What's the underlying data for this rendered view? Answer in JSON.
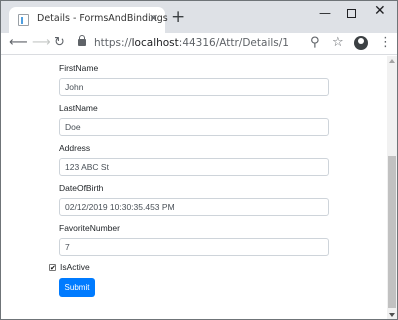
{
  "browser": {
    "tab_title": "Details - FormsAndBindings",
    "close_glyph": "✕",
    "new_tab_glyph": "+",
    "url_prefix": "https://",
    "url_host": "localhost",
    "url_rest": ":44316/Attr/Details/1",
    "icons": {
      "back": "back-arrow-icon",
      "forward": "forward-arrow-icon",
      "reload": "reload-icon",
      "lock": "lock-icon",
      "zoom": "zoom-icon",
      "star": "star-icon",
      "profile": "profile-icon",
      "menu": "menu-icon"
    }
  },
  "form": {
    "fields": [
      {
        "label": "FirstName",
        "value": "John"
      },
      {
        "label": "LastName",
        "value": "Doe"
      },
      {
        "label": "Address",
        "value": "123 ABC St"
      },
      {
        "label": "DateOfBirth",
        "value": "02/12/2019 10:30:35.453 PM"
      },
      {
        "label": "FavoriteNumber",
        "value": "7"
      }
    ],
    "checkbox": {
      "label": "IsActive",
      "checked": true,
      "mark": "✔"
    },
    "submit_label": "Submit"
  },
  "colors": {
    "primary": "#007bff",
    "tabstrip": "#dee1e6"
  }
}
